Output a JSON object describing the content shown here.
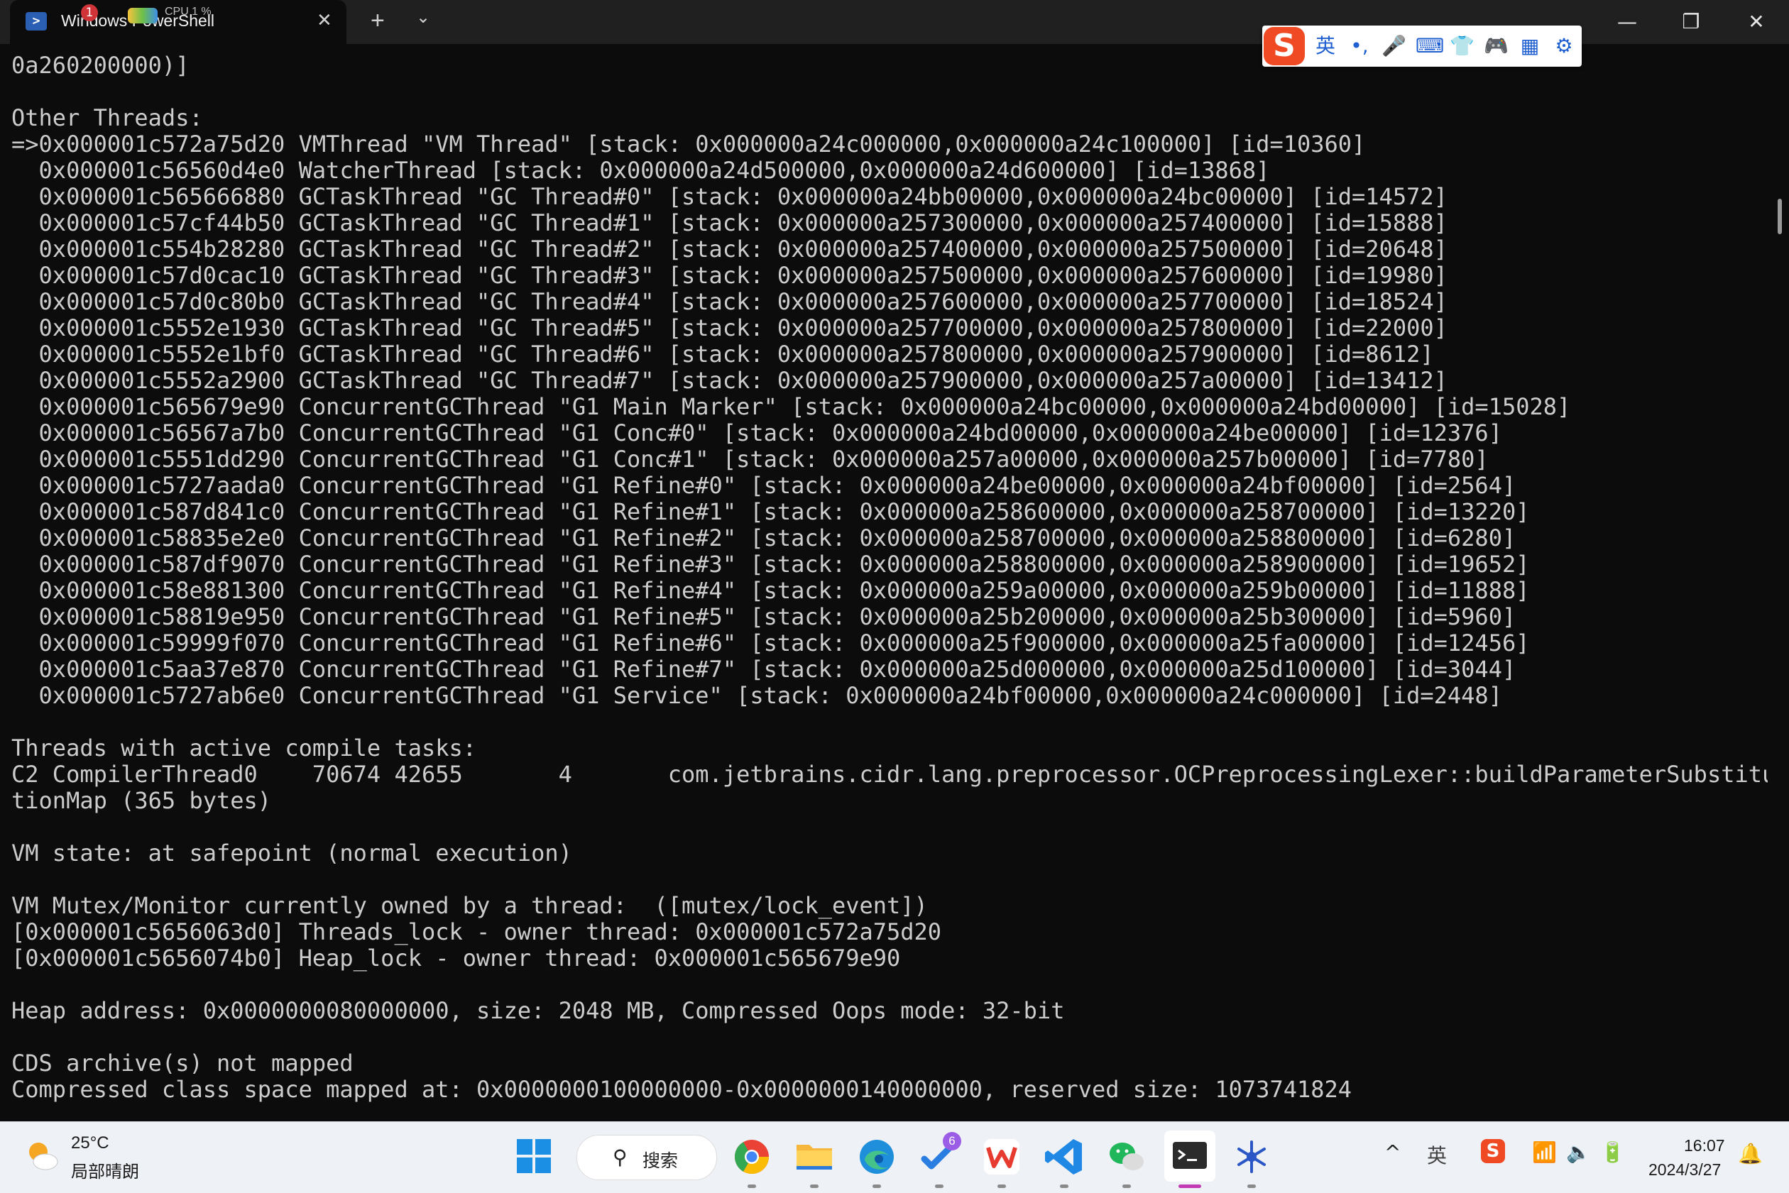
{
  "window": {
    "tab_title": "Windows PowerShell",
    "tab_badge": "1",
    "tab_cpu_label": "CPU",
    "tab_cpu_value": "1 %",
    "tab_close_glyph": "✕",
    "new_tab_glyph": "+",
    "dropdown_glyph": "⌄",
    "minimize_glyph": "—",
    "maximize_glyph": "❐",
    "close_glyph": "✕"
  },
  "ime": {
    "logo": "S",
    "items": [
      {
        "icon": "english-mode-icon",
        "glyph": "英"
      },
      {
        "icon": "punctuation-icon",
        "glyph": "•,"
      },
      {
        "icon": "microphone-icon",
        "glyph": "🎤"
      },
      {
        "icon": "keyboard-icon",
        "glyph": "⌨"
      },
      {
        "icon": "skin-icon",
        "glyph": "👕"
      },
      {
        "icon": "game-controller-icon",
        "glyph": "🎮"
      },
      {
        "icon": "toolbox-icon",
        "glyph": "▦"
      },
      {
        "icon": "settings-icon",
        "glyph": "⚙"
      }
    ]
  },
  "terminal": {
    "lines": [
      "0a260200000)]",
      "",
      "Other Threads:",
      "=>0x000001c572a75d20 VMThread \"VM Thread\" [stack: 0x000000a24c000000,0x000000a24c100000] [id=10360]",
      "  0x000001c56560d4e0 WatcherThread [stack: 0x000000a24d500000,0x000000a24d600000] [id=13868]",
      "  0x000001c565666880 GCTaskThread \"GC Thread#0\" [stack: 0x000000a24bb00000,0x000000a24bc00000] [id=14572]",
      "  0x000001c57cf44b50 GCTaskThread \"GC Thread#1\" [stack: 0x000000a257300000,0x000000a257400000] [id=15888]",
      "  0x000001c554b28280 GCTaskThread \"GC Thread#2\" [stack: 0x000000a257400000,0x000000a257500000] [id=20648]",
      "  0x000001c57d0cac10 GCTaskThread \"GC Thread#3\" [stack: 0x000000a257500000,0x000000a257600000] [id=19980]",
      "  0x000001c57d0c80b0 GCTaskThread \"GC Thread#4\" [stack: 0x000000a257600000,0x000000a257700000] [id=18524]",
      "  0x000001c5552e1930 GCTaskThread \"GC Thread#5\" [stack: 0x000000a257700000,0x000000a257800000] [id=22000]",
      "  0x000001c5552e1bf0 GCTaskThread \"GC Thread#6\" [stack: 0x000000a257800000,0x000000a257900000] [id=8612]",
      "  0x000001c5552a2900 GCTaskThread \"GC Thread#7\" [stack: 0x000000a257900000,0x000000a257a00000] [id=13412]",
      "  0x000001c565679e90 ConcurrentGCThread \"G1 Main Marker\" [stack: 0x000000a24bc00000,0x000000a24bd00000] [id=15028]",
      "  0x000001c56567a7b0 ConcurrentGCThread \"G1 Conc#0\" [stack: 0x000000a24bd00000,0x000000a24be00000] [id=12376]",
      "  0x000001c5551dd290 ConcurrentGCThread \"G1 Conc#1\" [stack: 0x000000a257a00000,0x000000a257b00000] [id=7780]",
      "  0x000001c5727aada0 ConcurrentGCThread \"G1 Refine#0\" [stack: 0x000000a24be00000,0x000000a24bf00000] [id=2564]",
      "  0x000001c587d841c0 ConcurrentGCThread \"G1 Refine#1\" [stack: 0x000000a258600000,0x000000a258700000] [id=13220]",
      "  0x000001c58835e2e0 ConcurrentGCThread \"G1 Refine#2\" [stack: 0x000000a258700000,0x000000a258800000] [id=6280]",
      "  0x000001c587df9070 ConcurrentGCThread \"G1 Refine#3\" [stack: 0x000000a258800000,0x000000a258900000] [id=19652]",
      "  0x000001c58e881300 ConcurrentGCThread \"G1 Refine#4\" [stack: 0x000000a259a00000,0x000000a259b00000] [id=11888]",
      "  0x000001c58819e950 ConcurrentGCThread \"G1 Refine#5\" [stack: 0x000000a25b200000,0x000000a25b300000] [id=5960]",
      "  0x000001c59999f070 ConcurrentGCThread \"G1 Refine#6\" [stack: 0x000000a25f900000,0x000000a25fa00000] [id=12456]",
      "  0x000001c5aa37e870 ConcurrentGCThread \"G1 Refine#7\" [stack: 0x000000a25d000000,0x000000a25d100000] [id=3044]",
      "  0x000001c5727ab6e0 ConcurrentGCThread \"G1 Service\" [stack: 0x000000a24bf00000,0x000000a24c000000] [id=2448]",
      "",
      "Threads with active compile tasks:",
      "C2 CompilerThread0    70674 42655       4       com.jetbrains.cidr.lang.preprocessor.OCPreprocessingLexer::buildParameterSubstitu",
      "tionMap (365 bytes)",
      "",
      "VM state: at safepoint (normal execution)",
      "",
      "VM Mutex/Monitor currently owned by a thread:  ([mutex/lock_event])",
      "[0x000001c5656063d0] Threads_lock - owner thread: 0x000001c572a75d20",
      "[0x000001c5656074b0] Heap_lock - owner thread: 0x000001c565679e90",
      "",
      "Heap address: 0x0000000080000000, size: 2048 MB, Compressed Oops mode: 32-bit",
      "",
      "CDS archive(s) not mapped",
      "Compressed class space mapped at: 0x0000000100000000-0x0000000140000000, reserved size: 1073741824"
    ]
  },
  "taskbar": {
    "weather_temp": "25°C",
    "weather_desc": "局部晴朗",
    "search_label": "搜索",
    "todo_badge": "6",
    "tray_ime_label": "英",
    "clock_time": "16:07",
    "clock_date": "2024/3/27",
    "colors": {
      "accent_underline": "#c239b3",
      "windows_blue": "#0a7cd8",
      "chrome_red": "#ea4335",
      "vscode_blue": "#1f88e5",
      "wechat_green": "#20b65a"
    }
  }
}
